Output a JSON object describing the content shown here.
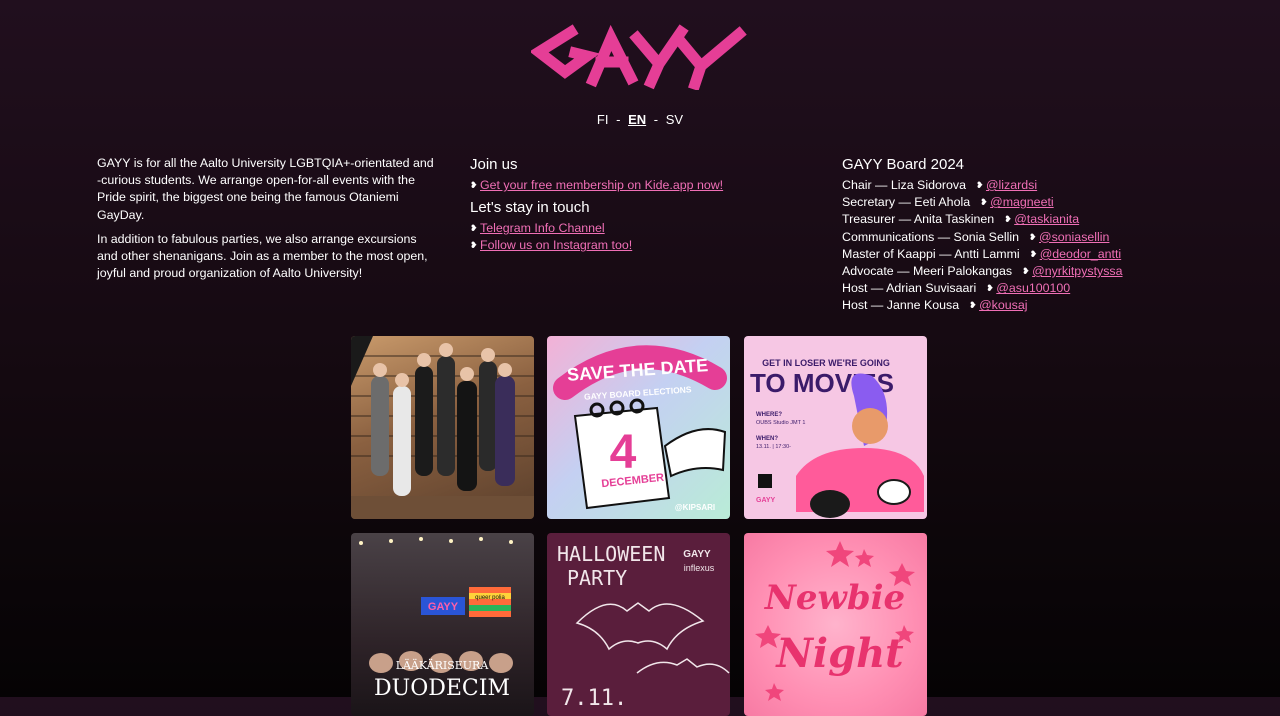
{
  "brand": {
    "logo_text": "GAYY",
    "accent": "#e53e96"
  },
  "lang": {
    "fi": "FI",
    "en": "EN",
    "sv": "SV",
    "sep": "-"
  },
  "intro": {
    "p1": "GAYY is for all the Aalto University LGBTQIA+-orientated and -curious students. We arrange open-for-all events with the Pride spirit, the biggest one being the famous Otaniemi GayDay.",
    "p2": "In addition to fabulous parties, we also arrange excursions and other shenanigans. Join as a member to the most open, joyful and proud organization of Aalto University!"
  },
  "join": {
    "title": "Join us",
    "membership_link": "Get your free membership on Kide.app now!"
  },
  "touch": {
    "title": "Let's stay in touch",
    "telegram_link": "Telegram Info Channel",
    "instagram_link": "Follow us on Instagram too!"
  },
  "board": {
    "title": "GAYY Board 2024",
    "members": [
      {
        "role": "Chair — Liza Sidorova",
        "handle": "@lizardsi"
      },
      {
        "role": "Secretary — Eeti Ahola",
        "handle": "@magneeti"
      },
      {
        "role": "Treasurer — Anita Taskinen",
        "handle": "@taskianita"
      },
      {
        "role": "Communications — Sonia Sellin",
        "handle": "@soniasellin"
      },
      {
        "role": "Master of Kaappi — Antti Lammi",
        "handle": "@deodor_antti"
      },
      {
        "role": "Advocate — Meeri Palokangas",
        "handle": "@nyrkitpystyssa"
      },
      {
        "role": "Host — Adrian Suvisaari",
        "handle": "@asu100100"
      },
      {
        "role": "Host — Janne Kousa",
        "handle": "@kousaj"
      }
    ]
  },
  "posts": {
    "p2": {
      "line1": "SAVE THE DATE",
      "line2": "GAYY BOARD ELECTIONS",
      "day": "4",
      "month": "DECEMBER",
      "credit": "@KIPSARI"
    },
    "p3": {
      "line1": "GET IN LOSER WE'RE GOING",
      "line2": "TO MOVIES",
      "where_label": "WHERE?",
      "where": "OUBS Studio JMT 1",
      "when_label": "WHEN?",
      "when": "13.11. | 17:30-",
      "brand": "GAYY"
    },
    "p4": {
      "line1": "LÄÄKÄRISEURA",
      "line2": "DUODECIM",
      "banner": "GAYY",
      "flag": "queer polia"
    },
    "p5": {
      "line1": "HALLOWEEN",
      "line2": "PARTY",
      "date": "7.11.",
      "brand1": "GAYY",
      "brand2": "inflexus"
    },
    "p6": {
      "line1": "Newbie",
      "line2": "Night"
    }
  }
}
